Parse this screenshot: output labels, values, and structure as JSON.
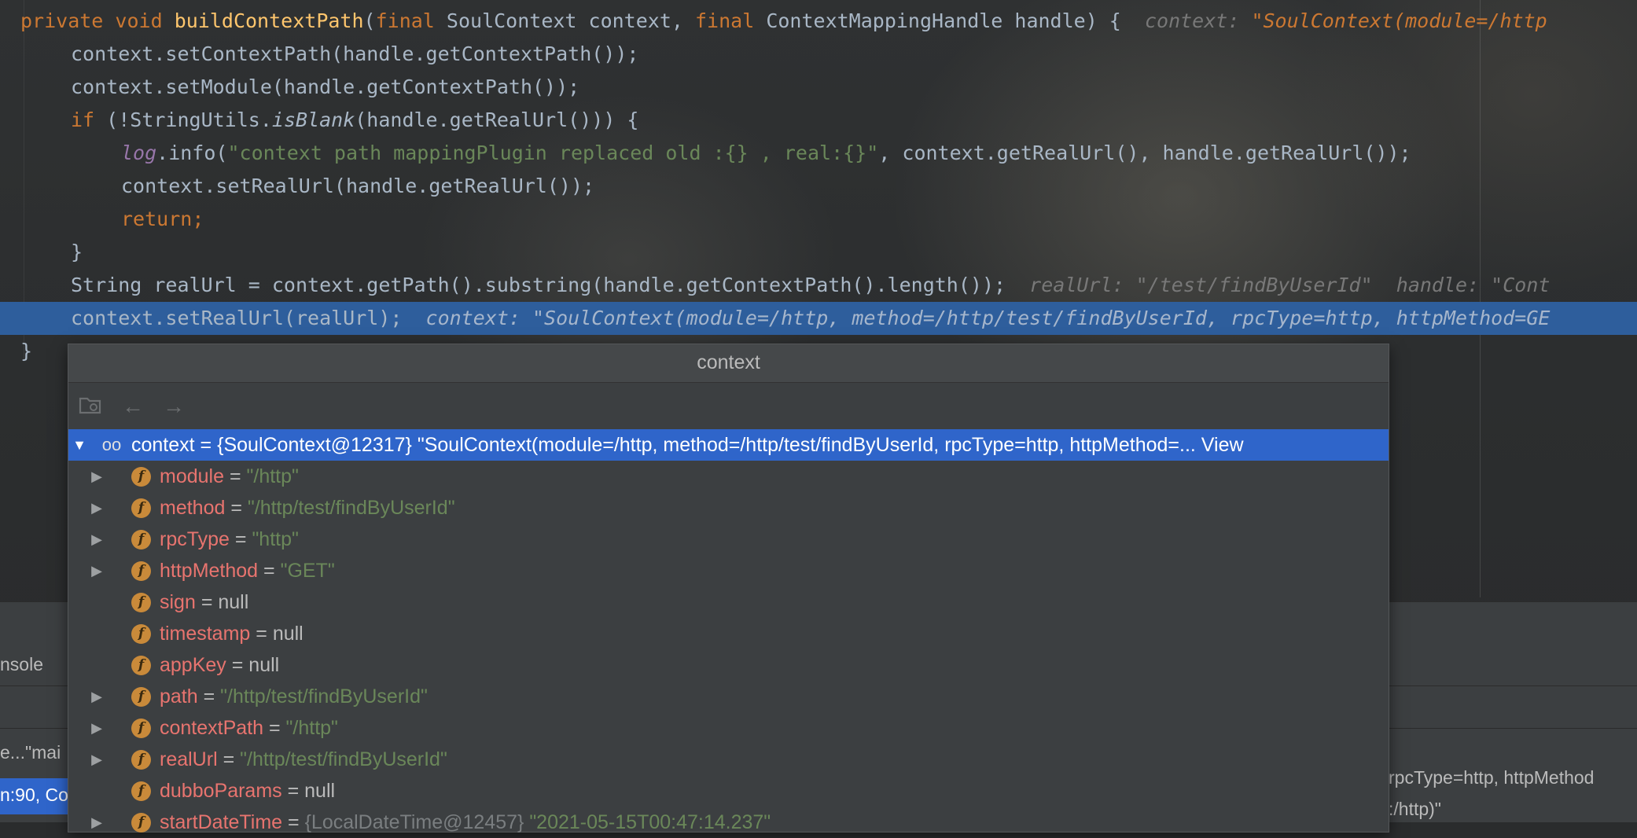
{
  "editor": {
    "line1": {
      "kw1": "private",
      "kw2": "void",
      "method": "buildContextPath",
      "open": "(",
      "kw3": "final",
      "p1": " SoulContext context, ",
      "kw4": "final",
      "p2": " ContextMappingHandle handle) {",
      "hint_label": "context: ",
      "hint_val": "\"SoulContext(module=/http"
    },
    "line2": "context.setContextPath(handle.getContextPath());",
    "line3": "context.setModule(handle.getContextPath());",
    "line4": {
      "kw": "if",
      "a": " (!StringUtils.",
      "b": "isBlank",
      "c": "(handle.getRealUrl())) {"
    },
    "line5": {
      "log": "log",
      "a": ".info(",
      "str": "\"context path mappingPlugin replaced old :{} , real:{}\"",
      "b": ", context.getRealUrl(), handle.getRealUrl());"
    },
    "line6": "context.setRealUrl(handle.getRealUrl());",
    "line7": {
      "kw": "return",
      "rest": ";"
    },
    "line8": "}",
    "line9": {
      "code": "String realUrl = context.getPath().substring(handle.getContextPath().length());",
      "hint": "realUrl: \"/test/findByUserId\"  handle: \"Cont"
    },
    "line10": {
      "code": "context.setRealUrl(realUrl);",
      "hint": "context: \"SoulContext(module=/http, method=/http/test/findByUserId, rpcType=http, httpMethod=GE"
    },
    "line11": "}"
  },
  "lower_panel": {
    "console_tab": "nsole",
    "frame_text": "e...\"mai",
    "selected_frame": "n:90, Co",
    "tail_line1": "rpcType=http, httpMethod",
    "tail_line2": ":/http)\""
  },
  "popup": {
    "title": "context",
    "root": {
      "name": "context",
      "eq": " = ",
      "value": "{SoulContext@12317} \"SoulContext(module=/http, method=/http/test/findByUserId, rpcType=http, httpMethod=... ",
      "view_link": "View"
    },
    "fields": [
      {
        "name": "module",
        "value": "\"/http\"",
        "kind": "str",
        "expandable": true
      },
      {
        "name": "method",
        "value": "\"/http/test/findByUserId\"",
        "kind": "str",
        "expandable": true
      },
      {
        "name": "rpcType",
        "value": "\"http\"",
        "kind": "str",
        "expandable": true
      },
      {
        "name": "httpMethod",
        "value": "\"GET\"",
        "kind": "str",
        "expandable": true
      },
      {
        "name": "sign",
        "value": "null",
        "kind": "null",
        "expandable": false
      },
      {
        "name": "timestamp",
        "value": "null",
        "kind": "null",
        "expandable": false
      },
      {
        "name": "appKey",
        "value": "null",
        "kind": "null",
        "expandable": false
      },
      {
        "name": "path",
        "value": "\"/http/test/findByUserId\"",
        "kind": "str",
        "expandable": true
      },
      {
        "name": "contextPath",
        "value": "\"/http\"",
        "kind": "str",
        "expandable": true
      },
      {
        "name": "realUrl",
        "value": "\"/http/test/findByUserId\"",
        "kind": "str",
        "expandable": true
      },
      {
        "name": "dubboParams",
        "value": "null",
        "kind": "null",
        "expandable": false
      },
      {
        "name": "startDateTime",
        "ref": "{LocalDateTime@12457} ",
        "value": "\"2021-05-15T00:47:14.237\"",
        "kind": "str",
        "expandable": true
      }
    ],
    "icons": [
      "folder-watch-icon",
      "back-arrow-icon",
      "forward-arrow-icon"
    ]
  },
  "colors": {
    "selection": "#2f65ca",
    "highlight_line": "#2e5e9c",
    "keyword": "#cc7832",
    "string": "#6a8759",
    "field_name": "#e8746f"
  }
}
